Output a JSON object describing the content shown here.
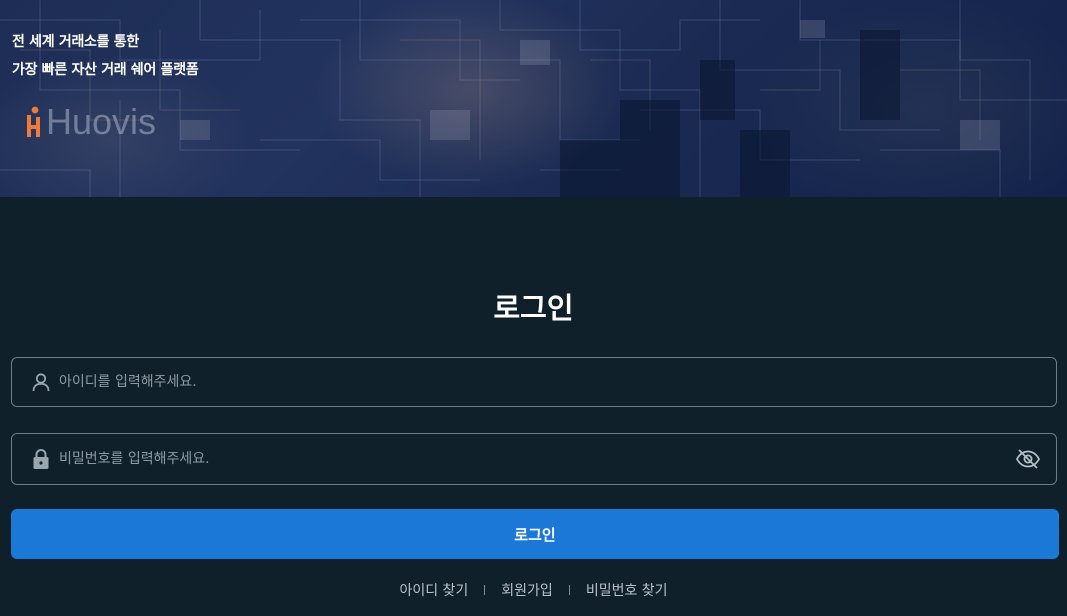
{
  "banner": {
    "line1": "전 세계 거래소를 통한",
    "line2": "가장 빠른 자산 거래 쉐어 플랫폼",
    "brand_name": "Huovis",
    "logo_icon": "huovis-figure-logo",
    "logo_color": "#f07a3a"
  },
  "form": {
    "title": "로그인",
    "id_placeholder": "아이디를 입력해주세요.",
    "id_icon": "user-icon",
    "pw_placeholder": "비밀번호를 입력해주세요.",
    "pw_icon": "lock-icon",
    "visibility_icon": "eye-off-icon",
    "submit_label": "로그인",
    "accent_color": "#1c78d6"
  },
  "links": {
    "find_id": "아이디 찾기",
    "signup": "회원가입",
    "find_pw": "비밀번호 찾기"
  }
}
